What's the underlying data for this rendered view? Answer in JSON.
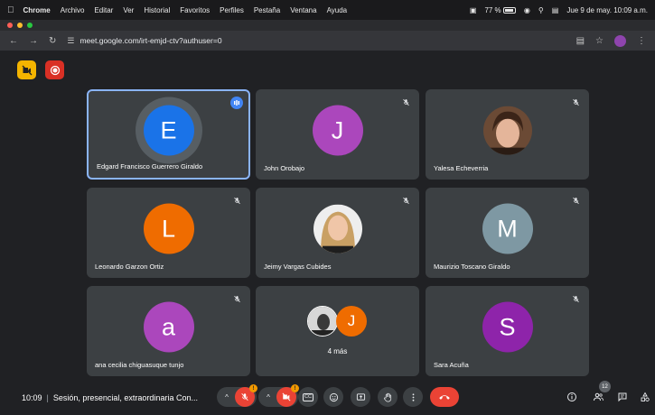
{
  "menubar": {
    "app": "Chrome",
    "items": [
      "Archivo",
      "Editar",
      "Ver",
      "Historial",
      "Favoritos",
      "Perfiles",
      "Pestaña",
      "Ventana",
      "Ayuda"
    ],
    "battery": "77 %",
    "datetime": "Jue 9 de may.  10:09 a.m."
  },
  "browser": {
    "url": "meet.google.com/irt-emjd-ctv?authuser=0"
  },
  "tiles": [
    {
      "id": "edgard",
      "name": "Edgard Francisco Guerrero Giraldo",
      "initial": "E",
      "color": "#1a73e8",
      "speaking": true
    },
    {
      "id": "john",
      "name": "John Orobajo",
      "initial": "J",
      "color": "#ab47bc",
      "muted": true
    },
    {
      "id": "yalesa",
      "name": "Yalesa Echeverria",
      "photo": "yalesa-photo",
      "muted": true
    },
    {
      "id": "leonardo",
      "name": "Leonardo Garzon Ortiz",
      "initial": "L",
      "color": "#ef6c00",
      "muted": true
    },
    {
      "id": "jeimy",
      "name": "Jeimy Vargas Cubides",
      "photo": "jeimy-photo",
      "muted": true
    },
    {
      "id": "maurizio",
      "name": "Maurizio Toscano Giraldo",
      "initial": "M",
      "color": "#7e98a3",
      "muted": true
    },
    {
      "id": "ana",
      "name": "ana cecilia chiguasuque tunjo",
      "initial": "a",
      "color": "#ab47bc",
      "muted": true
    },
    {
      "id": "more",
      "label": "4 más",
      "mini_initial": "J",
      "mini_color": "#ef6c00"
    },
    {
      "id": "sara",
      "name": "Sara Acuña",
      "initial": "S",
      "color": "#8e24aa",
      "muted": true
    }
  ],
  "bottom": {
    "time": "10:09",
    "meeting_title": "Sesión, presencial, extraordinaria Con...",
    "mic_badge": "!",
    "cam_badge": "!",
    "cc_label": "CC",
    "people_count": "12"
  },
  "colors": {
    "background": "#202124",
    "tile": "#3c4043",
    "danger": "#ea4335",
    "accent": "#8ab4f8"
  }
}
